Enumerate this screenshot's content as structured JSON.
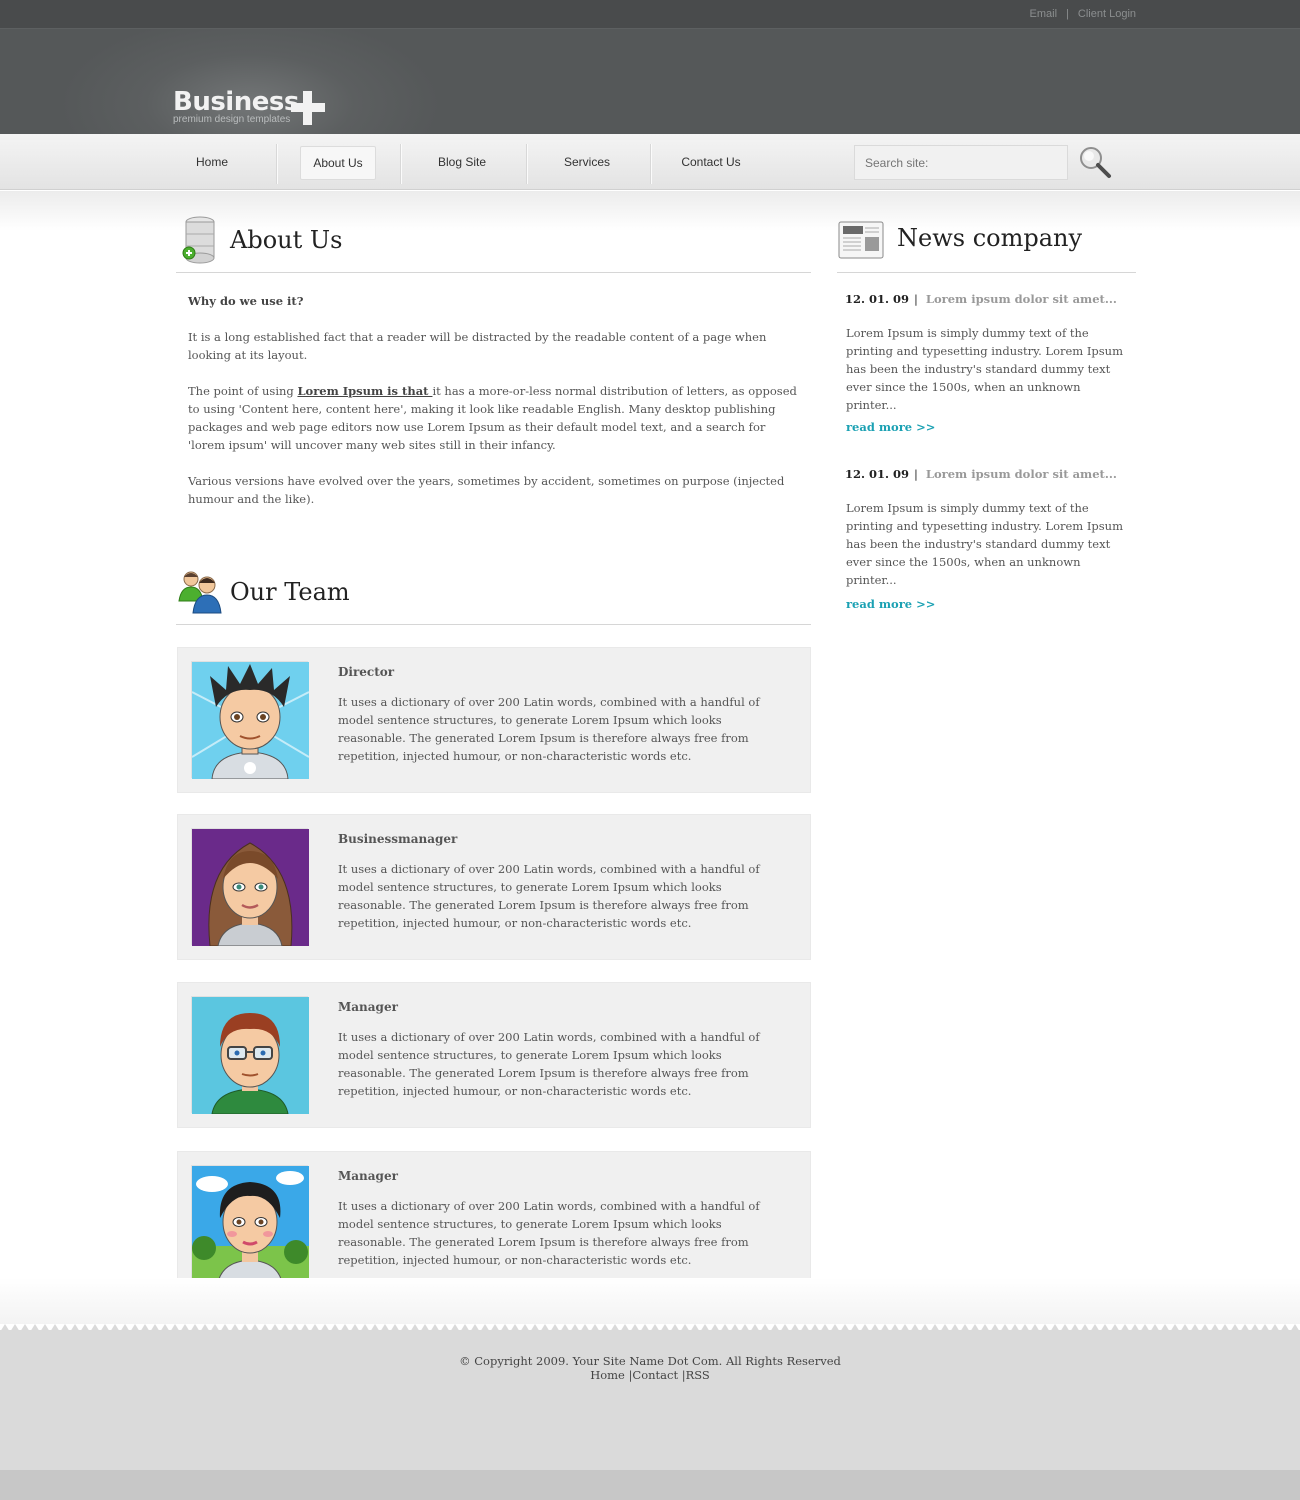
{
  "topbar": {
    "email": "Email",
    "separator": "|",
    "client_login": "Client Login"
  },
  "logo": {
    "title": "Business",
    "tagline": "premium design templates"
  },
  "nav": {
    "items": [
      {
        "label": "Home",
        "active": false
      },
      {
        "label": "About Us",
        "active": true
      },
      {
        "label": "Blog Site",
        "active": false
      },
      {
        "label": "Services",
        "active": false
      },
      {
        "label": "Contact Us",
        "active": false
      }
    ],
    "search_placeholder": "Search site:"
  },
  "about": {
    "title": "About Us",
    "question": "Why do we use it?",
    "para1": "It is a long established fact that a reader will be distracted by the readable content of a page when looking at its layout.",
    "para2_before": "The point of using ",
    "para2_link": "Lorem Ipsum is that ",
    "para2_after": "it has a more-or-less normal distribution of letters, as opposed to using 'Content here, content here', making it look like readable English. Many desktop publishing packages and web page editors now use Lorem Ipsum as their default model text, and a search for 'lorem ipsum' will uncover many web sites still in their infancy.",
    "para3": "Various versions have evolved over the years, sometimes by accident, sometimes on purpose (injected humour and the like)."
  },
  "team": {
    "title": "Our Team",
    "members": [
      {
        "role": "Director",
        "text": "It uses a dictionary of over 200 Latin words, combined with a handful of model sentence structures, to generate Lorem Ipsum which looks reasonable. The generated Lorem Ipsum is therefore always free from repetition, injected humour, or non-characteristic words etc."
      },
      {
        "role": "Businessmanager",
        "text": "It uses a dictionary of over 200 Latin words, combined with a handful of model sentence structures, to generate Lorem Ipsum which looks reasonable. The generated Lorem Ipsum is therefore always free from repetition, injected humour, or non-characteristic words etc."
      },
      {
        "role": "Manager",
        "text": "It uses a dictionary of over 200 Latin words, combined with a handful of model sentence structures, to generate Lorem Ipsum which looks reasonable. The generated Lorem Ipsum is therefore always free from repetition, injected humour, or non-characteristic words etc."
      },
      {
        "role": "Manager",
        "text": "It uses a dictionary of over 200 Latin words, combined with a handful of model sentence structures, to generate Lorem Ipsum which looks reasonable. The generated Lorem Ipsum is therefore always free from repetition, injected humour, or non-characteristic words etc."
      }
    ]
  },
  "news": {
    "title": "News company",
    "items": [
      {
        "date": "12. 01. 09",
        "separator": "|",
        "headline": "Lorem ipsum dolor sit amet...",
        "body": "Lorem Ipsum is simply dummy text of the printing and typesetting industry. Lorem Ipsum has been the industry's standard dummy text ever since the 1500s, when an unknown printer...",
        "read_more": "read more >>"
      },
      {
        "date": "12. 01. 09",
        "separator": "|",
        "headline": "Lorem ipsum dolor sit amet...",
        "body": "Lorem Ipsum is simply dummy text of the printing and typesetting industry. Lorem Ipsum has been the industry's standard dummy text ever since the 1500s, when an unknown printer...",
        "read_more": "read more >>"
      }
    ]
  },
  "footer": {
    "copyright": "© Copyright 2009. Your Site Name Dot Com. All Rights Reserved",
    "links": [
      "Home",
      "Contact",
      "RSS"
    ],
    "separator": "|"
  },
  "colors": {
    "accent": "#1ba1b3",
    "header": "#5a5d5e",
    "topbar": "#494b4c",
    "card": "#f0f0f0",
    "footer": "#dadada"
  },
  "icons": [
    "database-add-icon",
    "team-icon",
    "newspaper-icon",
    "search-icon",
    "avatar-director",
    "avatar-businessmanager",
    "avatar-manager-1",
    "avatar-manager-2"
  ]
}
